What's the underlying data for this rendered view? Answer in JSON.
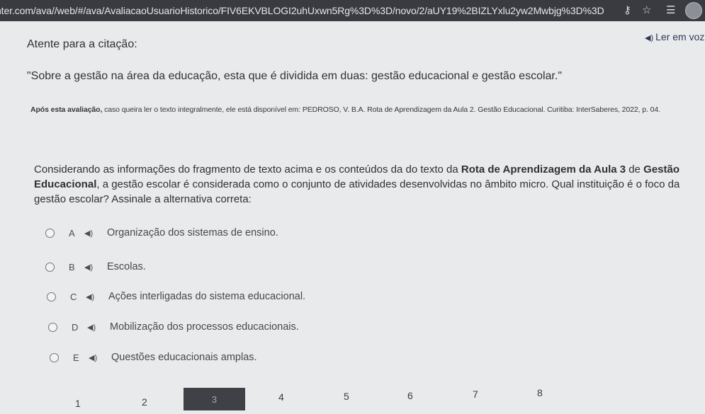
{
  "browser": {
    "url": "nter.com/ava//web/#/ava/AvaliacaoUsuarioHistorico/FIV6EKVBLOGI2uhUxwn5Rg%3D%3D/novo/2/aUY19%2BIZLYxlu2yw2Mwbjg%3D%3D",
    "icons": [
      "key-icon",
      "star-icon",
      "reading-list-icon",
      "profile-avatar"
    ]
  },
  "header": {
    "citation_label": "Atente para a citação:",
    "read_aloud_label": "Ler em voz",
    "read_aloud_icon": "speaker-icon"
  },
  "citation": {
    "quote": "\"Sobre a gestão na área da educação, esta que é dividida em duas: gestão educacional e gestão escolar.\"",
    "source_bold": "Após esta avaliação,",
    "source_rest": " caso queira ler o texto integralmente, ele está disponível em: PEDROSO, V. B.A. Rota de Aprendizagem da Aula 2. Gestão Educacional. Curitiba: InterSaberes, 2022, p. 04."
  },
  "question": {
    "part1": "Considerando as informações do fragmento de texto acima e os conteúdos da do texto da ",
    "bold1": "Rota de Aprendizagem da Aula 3",
    "part2": " de ",
    "bold2": "Gestão Educacional",
    "part3": ", a gestão escolar é considerada como o conjunto de atividades desenvolvidas no âmbito micro. Qual instituição é o foco da gestão escolar? Assinale a alternativa correta:"
  },
  "options": [
    {
      "letter": "A",
      "text": "Organização dos sistemas de ensino."
    },
    {
      "letter": "B",
      "text": "Escolas."
    },
    {
      "letter": "C",
      "text": "Ações interligadas do sistema educacional."
    },
    {
      "letter": "D",
      "text": "Mobilização dos processos educacionais."
    },
    {
      "letter": "E",
      "text": "Questões educacionais amplas."
    }
  ],
  "pagination": {
    "pages": [
      "1",
      "2",
      "3",
      "4",
      "5",
      "6",
      "7",
      "8"
    ],
    "current": "3"
  }
}
